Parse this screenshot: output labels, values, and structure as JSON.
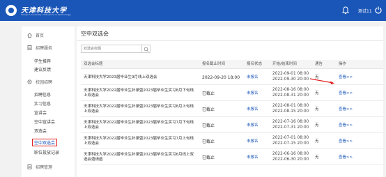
{
  "header": {
    "logo_cn": "天津科技大学",
    "logo_en": "Tianjin University of Science & Technology",
    "username": "测试11",
    "bell_icon": "bell-icon",
    "power_icon": "power-icon"
  },
  "sidebar": {
    "home": "首页",
    "groups": [
      {
        "label": "招聘服务",
        "icon": "document-icon",
        "items": [
          "学生推荐",
          "建议反馈"
        ]
      },
      {
        "label": "校园招聘",
        "icon": "settings-icon",
        "items": [
          "招聘信息",
          "实习信息",
          "宣讲会",
          "空中宣讲会",
          "双选会",
          "空中双选会",
          "职位投放记录"
        ]
      },
      {
        "label": "招聘管理",
        "icon": "document-icon",
        "items": []
      }
    ],
    "active_item": "空中双选会"
  },
  "main": {
    "title": "空中双选会",
    "search_placeholder": "双选会标题",
    "columns": [
      "双选会标题",
      "报名截止时间",
      "报名状态",
      "开始/结束时间",
      "通告",
      "操作"
    ],
    "rows": [
      {
        "name": "天津科技大学2023届毕业生9月线上双选会",
        "deadline": "2022-09-20 18:00",
        "status": "未报名",
        "start": "2022-09-01 08:00",
        "end": "2022-09-30 20:00",
        "notice": "无",
        "op": "查看>>"
      },
      {
        "name": "天津科技大学2022届毕业生补录暨2023届毕业生实习8月下旬线上双选会",
        "deadline": "已截止",
        "status": "未报名",
        "start": "2022-08-16 08:00",
        "end": "2022-08-31 20:00",
        "notice": "无",
        "op": "查看>>"
      },
      {
        "name": "天津科技大学2022届毕业生补录暨2023届毕业生实习8月上旬线上双选会",
        "deadline": "已截止",
        "status": "未报名",
        "start": "2022-08-01 08:00",
        "end": "2022-08-15 20:00",
        "notice": "无",
        "op": "查看>>"
      },
      {
        "name": "天津科技大学2022届毕业生补录暨2023届毕业生实习7月下旬线上双选会",
        "deadline": "已截止",
        "status": "未报名",
        "start": "2022-07-16 08:00",
        "end": "2022-07-31 20:00",
        "notice": "无",
        "op": "查看>>"
      },
      {
        "name": "天津科技大学2022届毕业生补录暨2023届毕业生实习7月上旬线上双选会",
        "deadline": "已截止",
        "status": "未报名",
        "start": "2022-07-01 08:00",
        "end": "2022-07-15 20:00",
        "notice": "无",
        "op": "查看>>"
      },
      {
        "name": "天津科技大学2022届毕业生补录暨2023届毕业生实习6月线上双选会邀请函",
        "deadline": "已截止",
        "status": "未报名",
        "start": "2022-06-16 08:00",
        "end": "2022-06-30 20:00",
        "notice": "无",
        "op": "查看>>"
      }
    ]
  },
  "colors": {
    "brand": "#1a56b8",
    "highlight": "#e02020"
  }
}
